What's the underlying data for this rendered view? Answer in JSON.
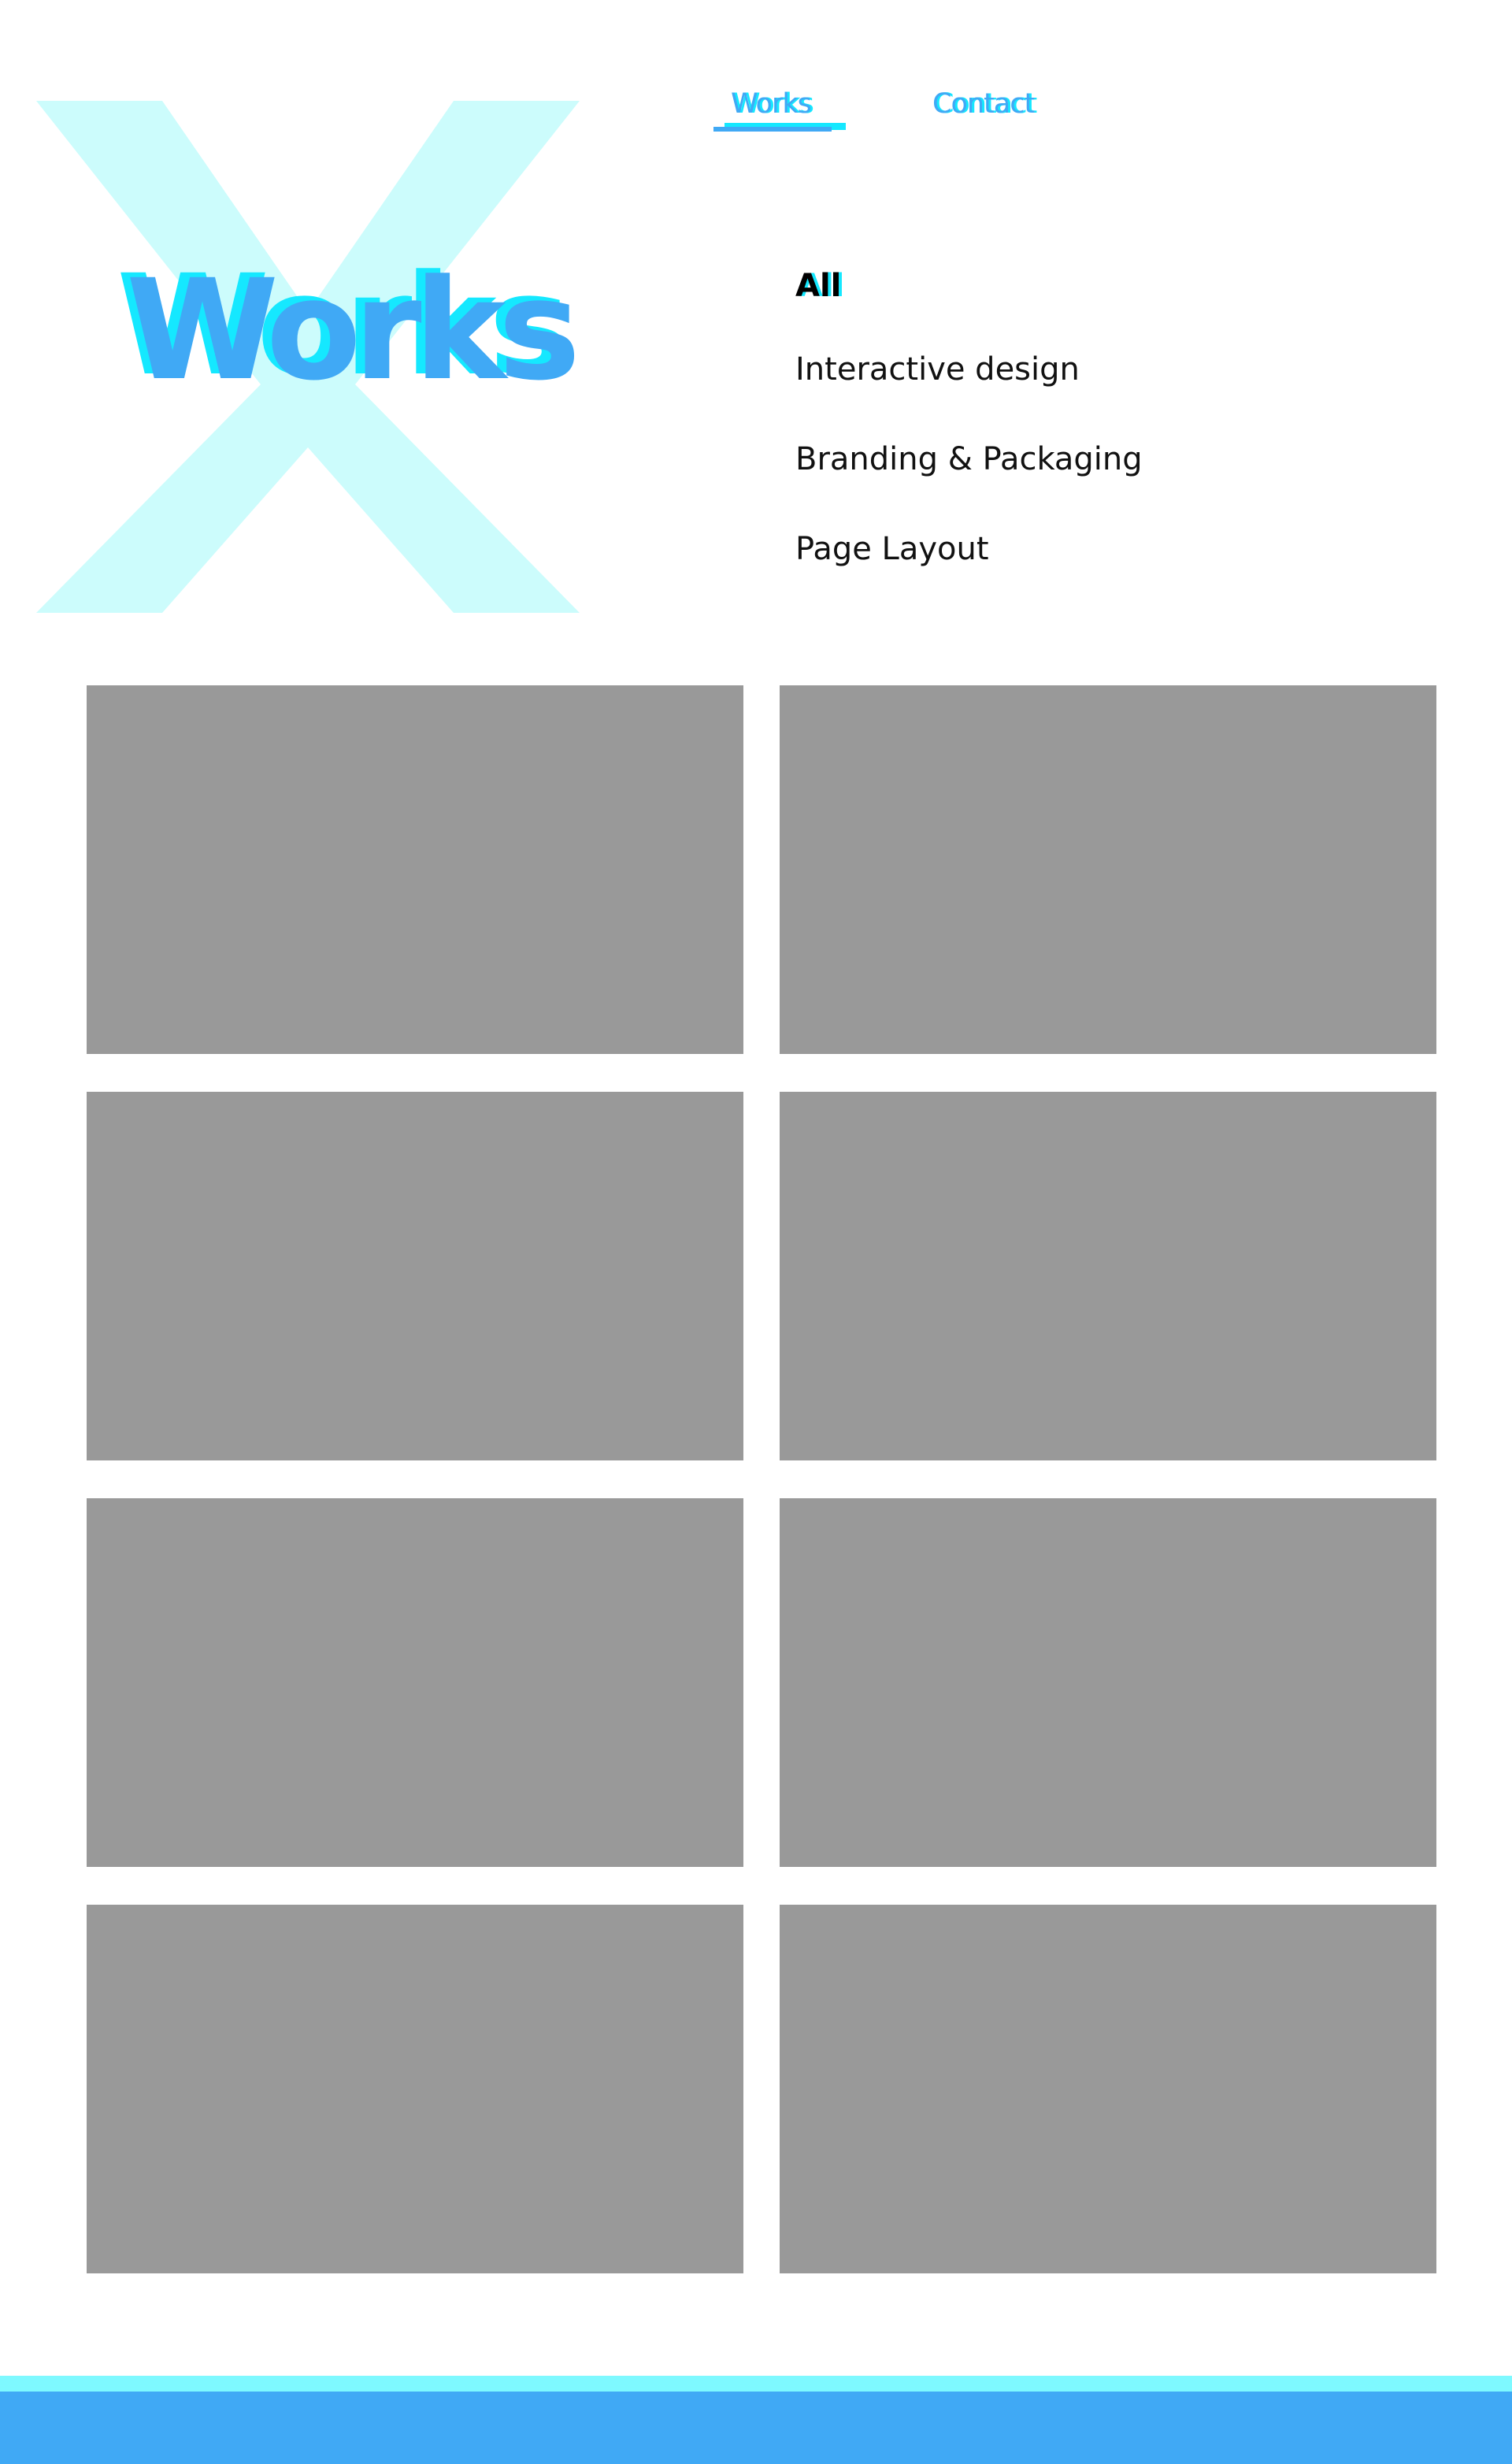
{
  "colors": {
    "accent_blue": "#40a9f5",
    "accent_cyan": "#15e8ff",
    "logo_x_tint": "#ccfcfc",
    "placeholder_gray": "#999999",
    "footer_line": "#7ef9ff"
  },
  "brand": {
    "logo_icon": "x-logo-icon"
  },
  "nav": {
    "items": [
      {
        "label": "Works",
        "active": true
      },
      {
        "label": "Contact",
        "active": false
      }
    ]
  },
  "hero": {
    "title": "Works"
  },
  "filters": {
    "items": [
      {
        "label": "All",
        "active": true
      },
      {
        "label": "Interactive design",
        "active": false
      },
      {
        "label": "Branding & Packaging",
        "active": false
      },
      {
        "label": "Page Layout",
        "active": false
      }
    ]
  },
  "works": {
    "card_count": 8
  }
}
